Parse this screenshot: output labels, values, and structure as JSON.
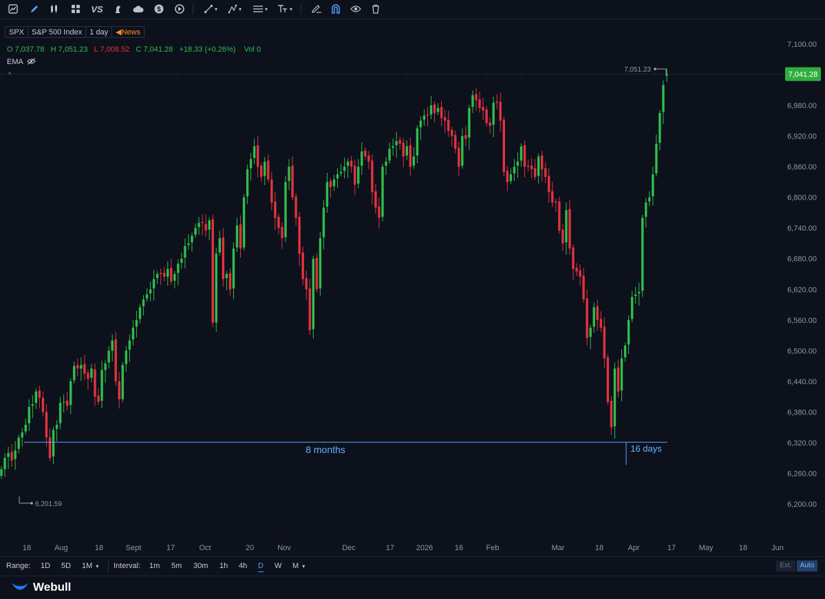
{
  "toolbar": {
    "icons": [
      "chart-type-icon",
      "pen-icon",
      "candle-icon",
      "grid-icon",
      "vs-icon",
      "strategy-icon",
      "cloud-icon",
      "dollar-icon",
      "replay-icon",
      "line-tool-icon",
      "pattern-tool-icon",
      "fib-tool-icon",
      "text-tool-icon",
      "edit-icon",
      "magnet-icon",
      "eye-icon",
      "trash-icon"
    ],
    "vs_label": "VS"
  },
  "symbol": {
    "ticker": "SPX",
    "name": "S&P 500 Index",
    "interval": "1 day",
    "news": "News"
  },
  "ohlc": {
    "o_label": "O",
    "o": "7,037.78",
    "h_label": "H",
    "h": "7,051.23",
    "l_label": "L",
    "l": "7,008.52",
    "c_label": "C",
    "c": "7,041.28",
    "change": "+18.33 (+0.26%)",
    "vol_label": "Vol",
    "vol": "0"
  },
  "indicator": {
    "name": "EMA"
  },
  "chart_data": {
    "type": "candlestick",
    "y_ticks": [
      "7,100.00",
      "6,980.00",
      "6,920.00",
      "6,860.00",
      "6,800.00",
      "6,740.00",
      "6,680.00",
      "6,620.00",
      "6,560.00",
      "6,500.00",
      "6,440.00",
      "6,380.00",
      "6,320.00",
      "6,260.00",
      "6,200.00"
    ],
    "ylim": [
      6165,
      7140
    ],
    "x_ticks": [
      "18",
      "Aug",
      "18",
      "Sept",
      "17",
      "Oct",
      "20",
      "Nov",
      "Dec",
      "17",
      "2026",
      "16",
      "Feb",
      "Mar",
      "18",
      "Apr",
      "17",
      "May",
      "18",
      "Jun"
    ],
    "last_price": "7,041.28",
    "high_marker": "7,051.23",
    "low_marker": "6,201.59",
    "measure_left_label": "8 months",
    "measure_right_label": "16 days",
    "measure_level": 6321,
    "colors": {
      "up": "#2fbf4a",
      "down": "#e2333f",
      "measure": "#5aa7ff",
      "price_tag": "#2fae3e"
    },
    "closes": [
      6268,
      6290,
      6300,
      6285,
      6305,
      6330,
      6340,
      6355,
      6390,
      6395,
      6420,
      6408,
      6380,
      6330,
      6290,
      6345,
      6355,
      6398,
      6400,
      6392,
      6440,
      6470,
      6465,
      6472,
      6455,
      6445,
      6465,
      6410,
      6400,
      6462,
      6475,
      6500,
      6520,
      6440,
      6405,
      6472,
      6500,
      6520,
      6545,
      6560,
      6585,
      6600,
      6610,
      6620,
      6640,
      6650,
      6650,
      6645,
      6660,
      6635,
      6650,
      6670,
      6680,
      6705,
      6710,
      6725,
      6740,
      6750,
      6750,
      6735,
      6755,
      6555,
      6690,
      6720,
      6640,
      6650,
      6620,
      6700,
      6745,
      6700,
      6800,
      6855,
      6875,
      6900,
      6860,
      6840,
      6870,
      6835,
      6790,
      6760,
      6740,
      6720,
      6830,
      6860,
      6800,
      6760,
      6690,
      6640,
      6620,
      6540,
      6680,
      6620,
      6720,
      6780,
      6830,
      6820,
      6835,
      6845,
      6850,
      6860,
      6870,
      6860,
      6825,
      6860,
      6890,
      6880,
      6870,
      6810,
      6780,
      6760,
      6860,
      6870,
      6895,
      6900,
      6910,
      6905,
      6880,
      6900,
      6860,
      6880,
      6935,
      6950,
      6960,
      6960,
      6980,
      6965,
      6975,
      6955,
      6950,
      6930,
      6920,
      6895,
      6860,
      6920,
      6915,
      6975,
      7000,
      6990,
      6975,
      6970,
      6945,
      6940,
      6985,
      6985,
      6950,
      6850,
      6830,
      6845,
      6860,
      6870,
      6900,
      6860,
      6860,
      6855,
      6840,
      6880,
      6855,
      6840,
      6810,
      6790,
      6790,
      6735,
      6710,
      6775,
      6700,
      6660,
      6655,
      6645,
      6600,
      6525,
      6545,
      6585,
      6560,
      6545,
      6485,
      6400,
      6350,
      6465,
      6420,
      6485,
      6510,
      6560,
      6605,
      6610,
      6615,
      6760,
      6790,
      6800,
      6845,
      6905,
      6965,
      7020,
      7041
    ],
    "opens": [
      6255,
      6268,
      6292,
      6302,
      6288,
      6308,
      6330,
      6342,
      6358,
      6392,
      6398,
      6422,
      6408,
      6380,
      6330,
      6293,
      6347,
      6358,
      6400,
      6402,
      6394,
      6442,
      6472,
      6465,
      6474,
      6457,
      6447,
      6463,
      6412,
      6402,
      6462,
      6477,
      6500,
      6522,
      6440,
      6405,
      6474,
      6502,
      6522,
      6547,
      6562,
      6587,
      6602,
      6612,
      6622,
      6642,
      6652,
      6652,
      6645,
      6662,
      6637,
      6652,
      6672,
      6682,
      6707,
      6712,
      6727,
      6742,
      6752,
      6748,
      6737,
      6757,
      6555,
      6692,
      6722,
      6642,
      6652,
      6622,
      6702,
      6747,
      6702,
      6802,
      6857,
      6877,
      6902,
      6862,
      6842,
      6872,
      6835,
      6792,
      6762,
      6742,
      6722,
      6832,
      6862,
      6802,
      6762,
      6692,
      6642,
      6622,
      6542,
      6682,
      6622,
      6722,
      6782,
      6832,
      6822,
      6837,
      6847,
      6852,
      6862,
      6872,
      6862,
      6827,
      6862,
      6892,
      6882,
      6872,
      6812,
      6782,
      6762,
      6862,
      6872,
      6897,
      6902,
      6912,
      6907,
      6882,
      6902,
      6862,
      6882,
      6937,
      6952,
      6962,
      6962,
      6982,
      6967,
      6977,
      6957,
      6952,
      6932,
      6922,
      6897,
      6862,
      6922,
      6917,
      6977,
      7002,
      6992,
      6977,
      6972,
      6947,
      6942,
      6987,
      6987,
      6952,
      6852,
      6832,
      6847,
      6862,
      6872,
      6902,
      6862,
      6862,
      6857,
      6842,
      6882,
      6857,
      6842,
      6812,
      6792,
      6792,
      6737,
      6712,
      6777,
      6702,
      6662,
      6657,
      6647,
      6602,
      6527,
      6547,
      6587,
      6562,
      6547,
      6487,
      6402,
      6352,
      6467,
      6422,
      6487,
      6512,
      6562,
      6607,
      6612,
      6617,
      6762,
      6792,
      6802,
      6847,
      6907,
      6967,
      7037.78
    ]
  }
}
